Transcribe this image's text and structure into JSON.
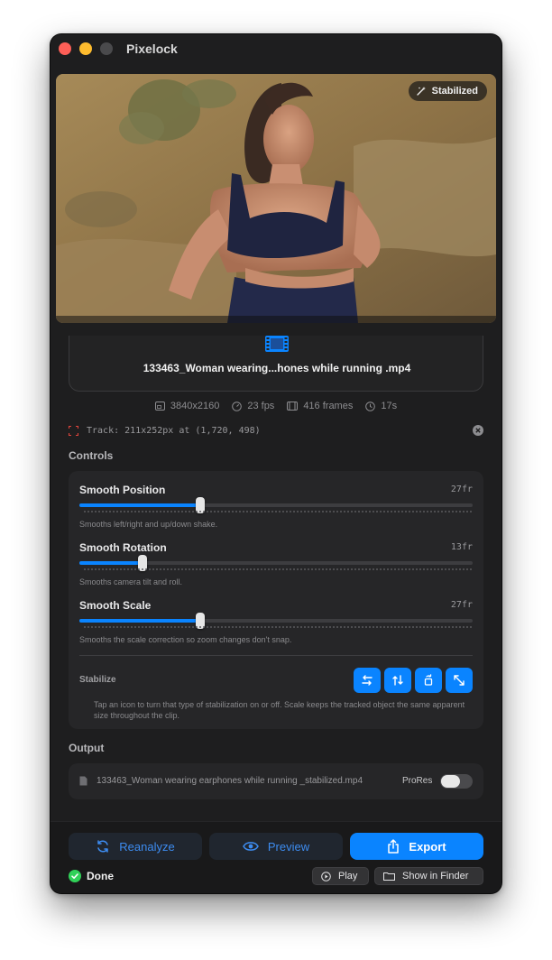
{
  "window": {
    "title": "Pixelock"
  },
  "video": {
    "badge_label": "Stabilized"
  },
  "file": {
    "name": "133463_Woman wearing...hones while running .mp4"
  },
  "metadata": {
    "resolution": "3840x2160",
    "fps": "23 fps",
    "frames": "416 frames",
    "duration": "17s"
  },
  "track": {
    "label": "Track: 211x252px at (1,720, 498)"
  },
  "controls": {
    "title": "Controls",
    "sliders": [
      {
        "label": "Smooth Position",
        "value_text": "27fr",
        "fraction": 0.307,
        "help": "Smooths left/right and up/down shake."
      },
      {
        "label": "Smooth Rotation",
        "value_text": "13fr",
        "fraction": 0.16,
        "help": "Smooths camera tilt and roll."
      },
      {
        "label": "Smooth Scale",
        "value_text": "27fr",
        "fraction": 0.307,
        "help": "Smooths the scale correction so zoom changes don't snap."
      }
    ],
    "stabilize": {
      "label": "Stabilize",
      "buttons": [
        "horizontal-stabilize-icon",
        "vertical-stabilize-icon",
        "rotation-stabilize-icon",
        "scale-stabilize-icon"
      ],
      "help": "Tap an icon to turn that type of stabilization on or off. Scale keeps the tracked object the same apparent size throughout the clip."
    }
  },
  "output": {
    "title": "Output",
    "file_name": "133463_Woman wearing earphones while running _stabilized.mp4",
    "prores_label": "ProRes",
    "prores_enabled": false
  },
  "actions": {
    "reanalyze": "Reanalyze",
    "preview": "Preview",
    "export": "Export"
  },
  "status": {
    "text": "Done",
    "play": "Play",
    "show_in_finder": "Show in Finder"
  },
  "colors": {
    "accent": "#0a84ff",
    "done": "#30d158",
    "window_bg": "#1e1e1f"
  }
}
